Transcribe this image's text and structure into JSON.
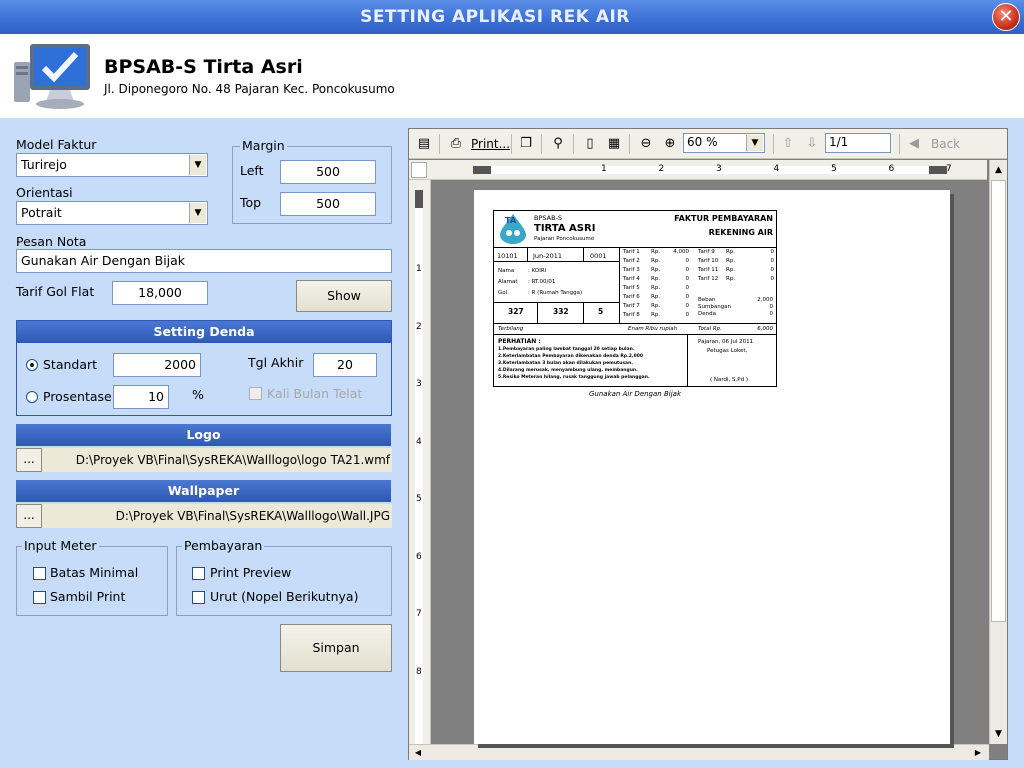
{
  "window": {
    "title": "SETTING APLIKASI REK AIR",
    "close_label": "✕"
  },
  "company": {
    "name": "BPSAB-S Tirta Asri",
    "address": "Jl. Diponegoro No. 48 Pajaran Kec. Poncokusumo"
  },
  "form": {
    "model_faktur": {
      "label": "Model Faktur",
      "value": "Turirejo"
    },
    "orientasi": {
      "label": "Orientasi",
      "value": "Potrait"
    },
    "margin": {
      "label": "Margin",
      "left_label": "Left",
      "left_value": "500",
      "top_label": "Top",
      "top_value": "500"
    },
    "pesan_nota": {
      "label": "Pesan Nota",
      "value": "Gunakan Air Dengan Bijak"
    },
    "tarif": {
      "label": "Tarif Gol Flat",
      "value": "18,000"
    },
    "show_button": "Show",
    "denda": {
      "header": "Setting Denda",
      "standart_label": "Standart",
      "standart_value": "2000",
      "prosentase_label": "Prosentase",
      "prosentase_value": "10",
      "percent": "%",
      "tgl_akhir_label": "Tgl Akhir",
      "tgl_akhir_value": "20",
      "kali_label": "Kali Bulan Telat"
    },
    "logo": {
      "header": "Logo",
      "button": "...",
      "path": "D:\\Proyek VB\\Final\\SysREKA\\Walllogo\\logo TA21.wmf"
    },
    "wallpaper": {
      "header": "Wallpaper",
      "button": "...",
      "path": "D:\\Proyek VB\\Final\\SysREKA\\Walllogo\\Wall.JPG"
    },
    "input_meter": {
      "label": "Input Meter",
      "batas": "Batas Minimal",
      "sambil": "Sambil Print"
    },
    "pembayaran": {
      "label": "Pembayaran",
      "preview": "Print Preview",
      "urut": "Urut (Nopel Berikutnya)"
    },
    "save_button": "Simpan"
  },
  "preview_toolbar": {
    "print": "Print...",
    "zoom": "60 %",
    "page": "1/1",
    "back": "Back"
  },
  "ruler": [
    "1",
    "2",
    "3",
    "4",
    "5",
    "6",
    "7"
  ],
  "vruler": [
    "1",
    "2",
    "3",
    "4",
    "5",
    "6",
    "7",
    "8"
  ],
  "invoice": {
    "org_small": "BPSAB-S",
    "org_big": "TIRTA ASRI",
    "org_sub": "Pajaran Poncokusumo",
    "title1": "FAKTUR PEMBAYARAN",
    "title2": "REKENING AIR",
    "id": "10101",
    "period": "Jun-2011",
    "seq": "0001",
    "nama_label": "Nama",
    "nama": ": KOIRI",
    "alamat_label": "Alamat",
    "alamat": ": RT.00/01",
    "gol_label": "Gol.",
    "gol": ": R (Rumah Tangga)",
    "meter_a": "327",
    "meter_b": "332",
    "meter_c": "5",
    "tarif_left": [
      {
        "name": "Tarif 1",
        "rp": "Rp.",
        "val": "4,000"
      },
      {
        "name": "Tarif 2",
        "rp": "Rp.",
        "val": "0"
      },
      {
        "name": "Tarif 3",
        "rp": "Rp.",
        "val": "0"
      },
      {
        "name": "Tarif 4",
        "rp": "Rp.",
        "val": "0"
      },
      {
        "name": "Tarif 5",
        "rp": "Rp.",
        "val": "0"
      },
      {
        "name": "Tarif 6",
        "rp": "Rp.",
        "val": "0"
      },
      {
        "name": "Tarif 7",
        "rp": "Rp.",
        "val": "0"
      },
      {
        "name": "Tarif 8",
        "rp": "Rp.",
        "val": "0"
      }
    ],
    "tarif_right": [
      {
        "name": "Tarif 9",
        "rp": "Rp.",
        "val": "0"
      },
      {
        "name": "Tarif 10",
        "rp": "Rp.",
        "val": "0"
      },
      {
        "name": "Tarif 11",
        "rp": "Rp.",
        "val": "0"
      },
      {
        "name": "Tarif 12",
        "rp": "Rp.",
        "val": "0"
      }
    ],
    "beban_label": "Beban",
    "beban": "2,000",
    "sumbangan_label": "Sumbangan",
    "sumbangan": "0",
    "denda_label": "Denda",
    "denda": "0",
    "terbilang_label": "Terbilang",
    "terbilang": "Enam Ribu rupiah",
    "total_label": "Total  Rp.",
    "total": "6,000",
    "perhatian": "PERHATIAN :",
    "notes": [
      "1.Pembayaran paling lambat tanggal 20 setiap bulan.",
      "2.Keterlambatan Pembayaran dikenakan denda Rp.2,000",
      "3.Keterlambatan 3 bulan akan dilakukan pemutusan.",
      "4.Dilarang merusak, menyambung ulang, membangun.",
      "5.Resiko Meteran hilang, rusak tanggung jawab pelanggan."
    ],
    "date_line": "Pajaran, 06 Jul 2011",
    "petugas": "Petugas Loket,",
    "officer": "( Nardi, S.Pd )",
    "footer_msg": "Gunakan Air Dengan Bijak"
  }
}
